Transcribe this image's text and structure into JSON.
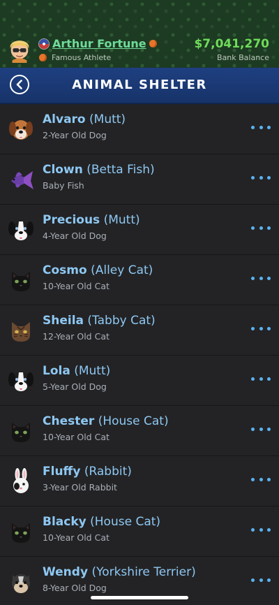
{
  "profile": {
    "name": "Arthur Fortune",
    "title": "Famous Athlete",
    "balance": "$7,041,270",
    "balance_label": "Bank Balance"
  },
  "header": {
    "title": "ANIMAL SHELTER",
    "back_icon": "chevron-left-icon"
  },
  "animals": [
    {
      "name": "Alvaro",
      "breed": "(Mutt)",
      "age": "2-Year Old Dog",
      "icon": "dog-brown"
    },
    {
      "name": "Clown",
      "breed": "(Betta Fish)",
      "age": "Baby Fish",
      "icon": "fish"
    },
    {
      "name": "Precious",
      "breed": "(Mutt)",
      "age": "4-Year Old Dog",
      "icon": "dog-bw"
    },
    {
      "name": "Cosmo",
      "breed": "(Alley Cat)",
      "age": "10-Year Old Cat",
      "icon": "cat-black"
    },
    {
      "name": "Sheila",
      "breed": "(Tabby Cat)",
      "age": "12-Year Old Cat",
      "icon": "cat-brown"
    },
    {
      "name": "Lola",
      "breed": "(Mutt)",
      "age": "5-Year Old Dog",
      "icon": "dog-bw"
    },
    {
      "name": "Chester",
      "breed": "(House Cat)",
      "age": "10-Year Old Cat",
      "icon": "cat-black"
    },
    {
      "name": "Fluffy",
      "breed": "(Rabbit)",
      "age": "3-Year Old Rabbit",
      "icon": "rabbit"
    },
    {
      "name": "Blacky",
      "breed": "(House Cat)",
      "age": "10-Year Old Cat",
      "icon": "cat-black"
    },
    {
      "name": "Wendy",
      "breed": "(Yorkshire Terrier)",
      "age": "8-Year Old Dog",
      "icon": "dog-yorkie"
    }
  ],
  "colors": {
    "accent_name": "#8ec8f3",
    "more_dots": "#5ab2f0",
    "balance": "#6fdc5a",
    "header_bg": "#1e3f80"
  }
}
